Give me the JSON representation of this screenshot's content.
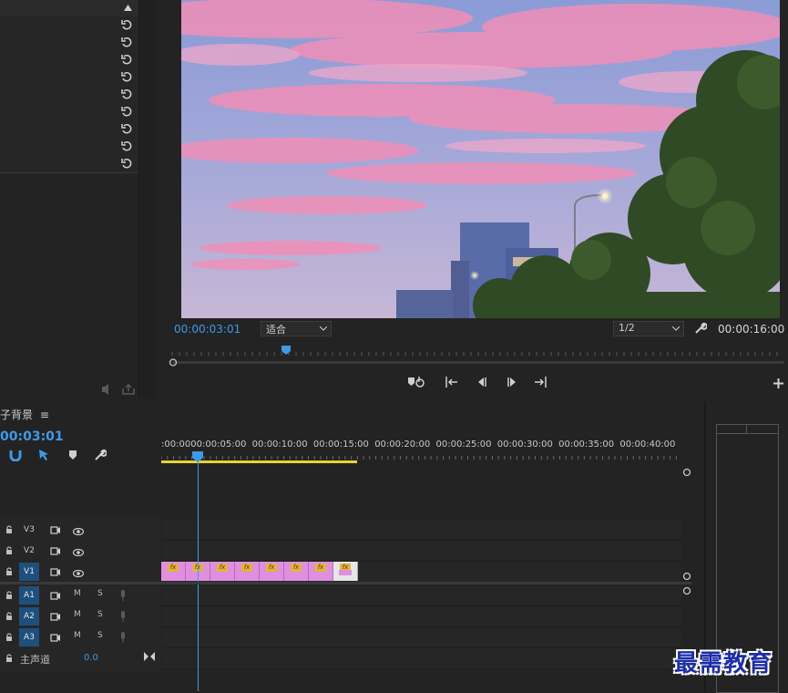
{
  "monitor": {
    "current_timecode": "00:00:03:01",
    "fit_label": "适合",
    "resolution_label": "1/2",
    "duration_timecode": "00:00:16:00"
  },
  "timeline": {
    "sequence_name": "子背景",
    "current_timecode": "00:03:01",
    "ruler_labels": [
      ":00:00",
      "00:00:05:00",
      "00:00:10:00",
      "00:00:15:00",
      "00:00:20:00",
      "00:00:25:00",
      "00:00:30:00",
      "00:00:35:00",
      "00:00:40:00"
    ],
    "video_tracks": [
      "V3",
      "V2",
      "V1"
    ],
    "audio_tracks": [
      "A1",
      "A2",
      "A3"
    ],
    "mute_label": "M",
    "solo_label": "S",
    "master_label": "主声道",
    "master_value": "0.0",
    "clip_count": 8,
    "fx_badge": "fx"
  },
  "watermark": "最需教育",
  "colors": {
    "accent_blue": "#3d9ae8",
    "clip_pink": "#e08fe0",
    "work_area_yellow": "#e7d33a",
    "track_selected": "#1f4f7c"
  }
}
